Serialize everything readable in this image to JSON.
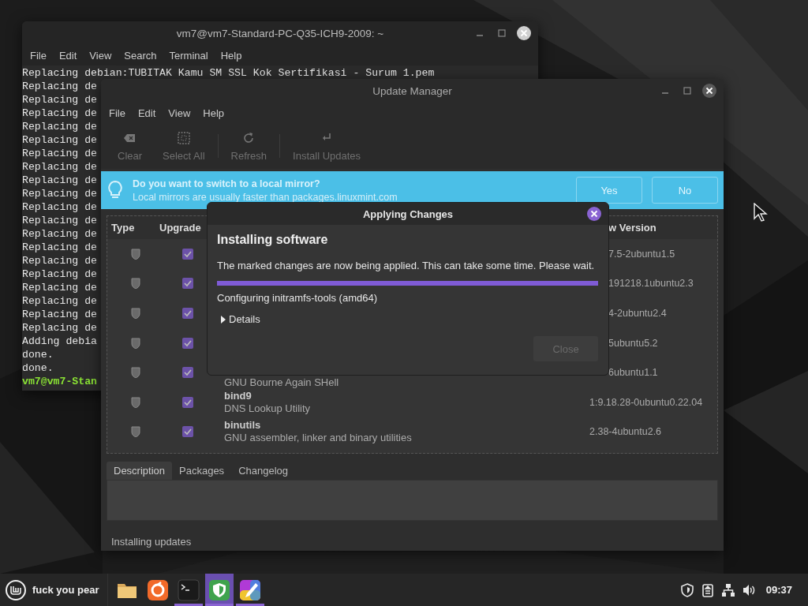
{
  "terminal": {
    "title": "vm7@vm7-Standard-PC-Q35-ICH9-2009: ~",
    "menu": [
      "File",
      "Edit",
      "View",
      "Search",
      "Terminal",
      "Help"
    ],
    "lines": [
      {
        "kind": "output",
        "text": "Replacing debian:TUBITAK Kamu SM SSL Kok Sertifikasi - Surum 1.pem"
      },
      {
        "kind": "output",
        "text": "Replacing de"
      },
      {
        "kind": "output",
        "text": "Replacing de"
      },
      {
        "kind": "output",
        "text": "Replacing de"
      },
      {
        "kind": "output",
        "text": "Replacing de"
      },
      {
        "kind": "output",
        "text": "Replacing de"
      },
      {
        "kind": "output",
        "text": "Replacing de"
      },
      {
        "kind": "output",
        "text": "Replacing de"
      },
      {
        "kind": "output",
        "text": "Replacing de"
      },
      {
        "kind": "output",
        "text": "Replacing de"
      },
      {
        "kind": "output",
        "text": "Replacing de"
      },
      {
        "kind": "output",
        "text": "Replacing de"
      },
      {
        "kind": "output",
        "text": "Replacing de"
      },
      {
        "kind": "output",
        "text": "Replacing de"
      },
      {
        "kind": "output",
        "text": "Replacing de"
      },
      {
        "kind": "output",
        "text": "Replacing de"
      },
      {
        "kind": "output",
        "text": "Replacing de"
      },
      {
        "kind": "output",
        "text": "Replacing de"
      },
      {
        "kind": "output",
        "text": "Replacing de"
      },
      {
        "kind": "output",
        "text": "Replacing de"
      },
      {
        "kind": "output",
        "text": "Adding debia"
      },
      {
        "kind": "output",
        "text": "done."
      },
      {
        "kind": "output",
        "text": "done."
      },
      {
        "kind": "prompt",
        "text": "vm7@vm7-Stan"
      }
    ]
  },
  "update_manager": {
    "title": "Update Manager",
    "menu": [
      "File",
      "Edit",
      "View",
      "Help"
    ],
    "toolbar": [
      {
        "kind": "clear",
        "label": "Clear",
        "disabled": true
      },
      {
        "kind": "select_all",
        "label": "Select All",
        "disabled": true
      },
      {
        "kind": "refresh",
        "label": "Refresh",
        "disabled": true
      },
      {
        "kind": "install",
        "label": "Install Updates",
        "disabled": true
      }
    ],
    "banner": {
      "title": "Do you want to switch to a local mirror?",
      "text": "Local mirrors are usually faster than packages.linuxmint.com",
      "buttons": [
        "Yes",
        "No"
      ]
    },
    "table": {
      "columns": [
        "Type",
        "Upgrade",
        "w Version"
      ],
      "rows": [
        {
          "upgrade": true,
          "version": "7.5-2ubuntu1.5"
        },
        {
          "upgrade": true,
          "version": "191218.1ubuntu2.3"
        },
        {
          "upgrade": true,
          "version": "4-2ubuntu2.4"
        },
        {
          "upgrade": true,
          "version": "5ubuntu5.2"
        },
        {
          "upgrade": true,
          "description": "GNU Bourne Again SHell",
          "version": "6ubuntu1.1"
        },
        {
          "upgrade": true,
          "name": "bind9",
          "description": "DNS Lookup Utility",
          "version": "1:9.18.28-0ubuntu0.22.04"
        },
        {
          "upgrade": true,
          "name": "binutils",
          "description": "GNU assembler, linker and binary utilities",
          "version": "2.38-4ubuntu2.6"
        }
      ]
    },
    "tabs": [
      {
        "label": "Description",
        "selected": true
      },
      {
        "label": "Packages",
        "selected": false
      },
      {
        "label": "Changelog",
        "selected": false
      }
    ],
    "status": "Installing updates"
  },
  "dialog": {
    "title": "Applying Changes",
    "heading": "Installing software",
    "message": "The marked changes are now being applied. This can take some time. Please wait.",
    "progress": {
      "level": 1
    },
    "status": "Configuring initramfs-tools (amd64)",
    "details": {
      "label": "Details",
      "expanded": false
    },
    "close_button": {
      "label": "Close",
      "disabled": true
    }
  },
  "taskbar": {
    "menu_label": "fuck you pear",
    "apps": [
      {
        "kind": "folder",
        "running": false,
        "focused": false
      },
      {
        "kind": "browser",
        "running": false,
        "focused": false
      },
      {
        "kind": "terminal",
        "running": true,
        "focused": false
      },
      {
        "kind": "shield",
        "running": true,
        "focused": true
      },
      {
        "kind": "paint",
        "running": true,
        "focused": false
      }
    ],
    "tray": [
      {
        "kind": "shield"
      },
      {
        "kind": "clipboard"
      },
      {
        "kind": "network"
      },
      {
        "kind": "volume"
      }
    ],
    "clock": "09:37"
  }
}
